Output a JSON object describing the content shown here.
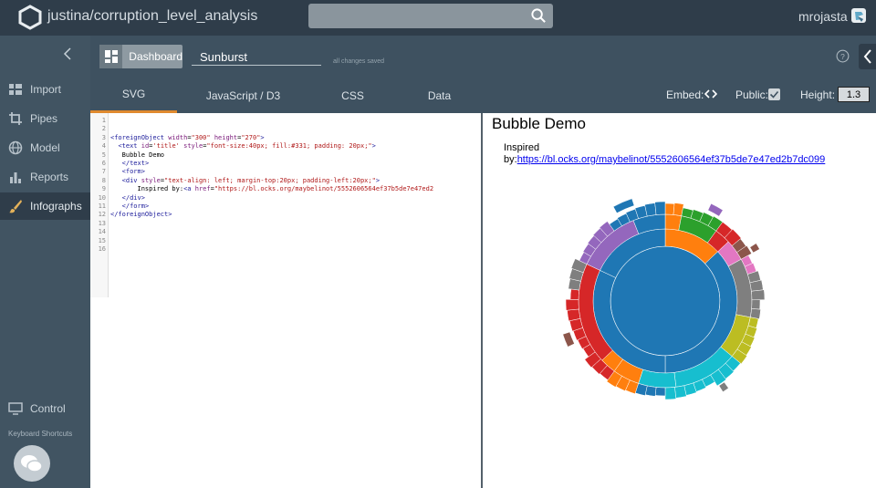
{
  "header": {
    "project_title": "justina/corruption_level_analysis",
    "username": "mrojasta",
    "icons": {
      "logo": "hexagon-logo-icon",
      "search": "search-icon",
      "avatar": "user-avatar-icon"
    }
  },
  "sidebar": {
    "items": [
      {
        "label": "Import",
        "icon": "import-grid-icon"
      },
      {
        "label": "Pipes",
        "icon": "pipes-crop-icon"
      },
      {
        "label": "Model",
        "icon": "globe-icon"
      },
      {
        "label": "Reports",
        "icon": "bar-chart-icon"
      },
      {
        "label": "Infographs",
        "icon": "brush-icon"
      },
      {
        "label": "Control",
        "icon": "monitor-icon"
      }
    ],
    "active": "Infographs",
    "keyboard_shortcuts": "Keyboard Shortcuts",
    "chat_icon": "chat-bubbles-icon"
  },
  "toolbar": {
    "dashboard_label": "Dashboard",
    "name_value": "Sunburst",
    "saved_status": "all changes saved"
  },
  "tabs": {
    "items": [
      "SVG",
      "JavaScript / D3",
      "CSS",
      "Data"
    ],
    "active": "SVG",
    "embed_label": "Embed:",
    "public_label": "Public:",
    "public_checked": true,
    "height_label": "Height:",
    "height_value": "1.3"
  },
  "editor": {
    "line_numbers": [
      "1",
      "2",
      "3",
      "4",
      "5",
      "6",
      "7",
      "8",
      "9",
      "10",
      "11",
      "12",
      "13",
      "14",
      "15",
      "16"
    ],
    "lines": [
      "",
      "",
      "<foreignObject width=\"300\" height=\"270\">",
      "  <text id='title' style=\"font-size:40px; fill:#331; padding: 20px;\">",
      "   Bubble Demo",
      "   </text>",
      "   <form>",
      "   <div style=\"text-align: left; margin-top:20px; padding-left:20px;\">",
      "       Inspired by:<a href=\"https://bl.ocks.org/maybelinot/5552606564ef37b5de7e47ed2",
      "   </div>",
      "   </form>",
      "</foreignObject>",
      "",
      "",
      "",
      ""
    ]
  },
  "preview": {
    "title": "Bubble Demo",
    "inspired_prefix": "Inspired",
    "inspired_by": "by:",
    "link_text": "https://bl.ocks.org/maybelinot/5552606564ef37b5de7e47ed2b7dc099"
  },
  "sunburst_colors": [
    "#1f77b4",
    "#ff7f0e",
    "#2ca02c",
    "#d62728",
    "#9467bd",
    "#8c564b",
    "#e377c2",
    "#7f7f7f",
    "#bcbd22",
    "#17becf"
  ]
}
